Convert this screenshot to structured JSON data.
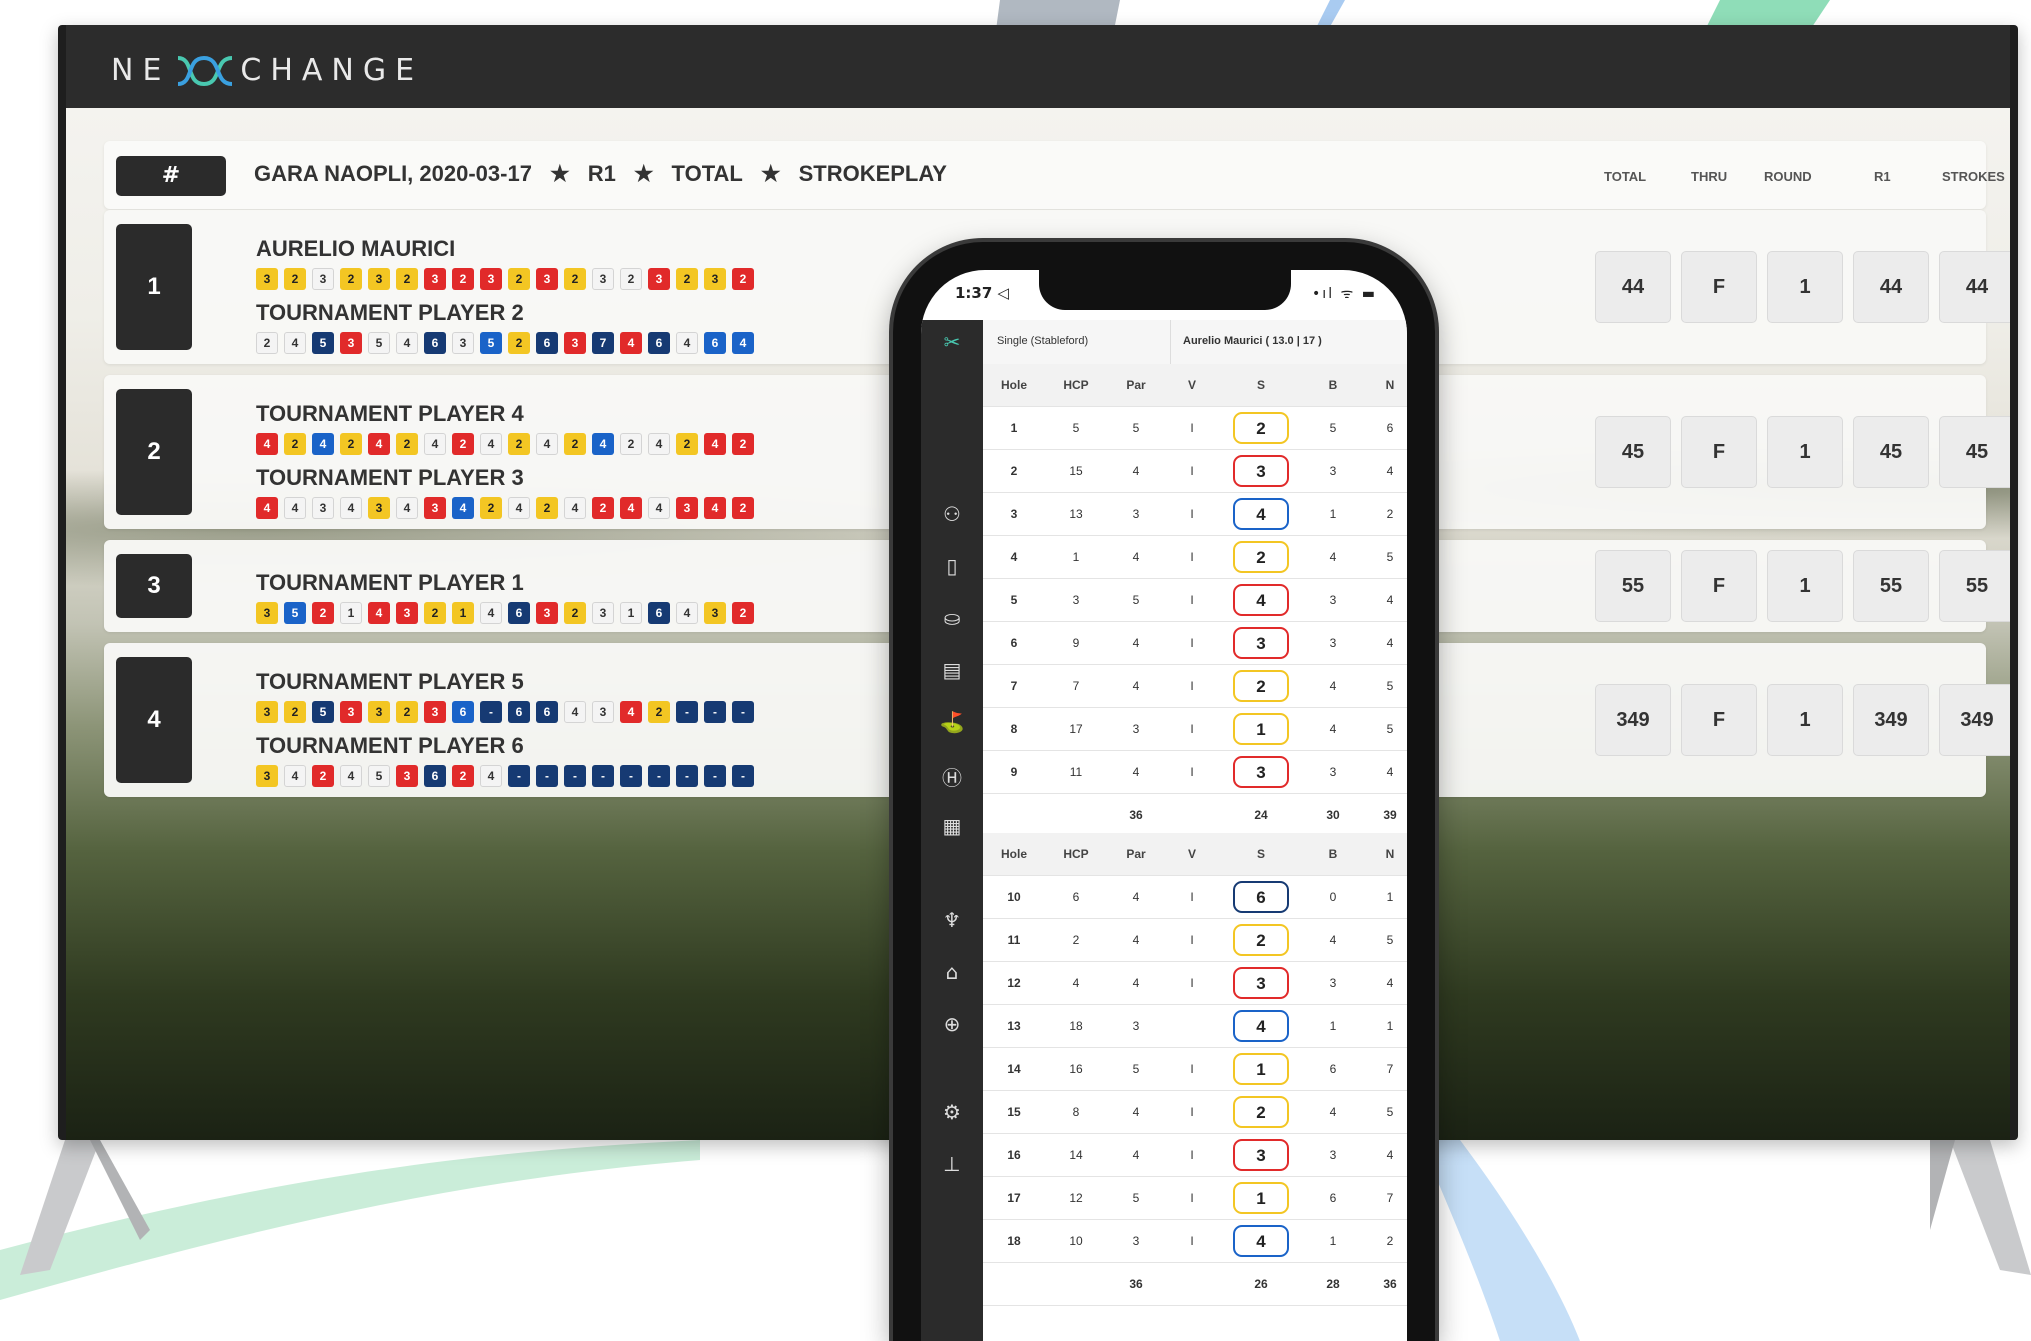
{
  "app": {
    "logo_left": "NE",
    "logo_right": "CHANGE"
  },
  "header": {
    "hash": "#",
    "title_parts": [
      "GARA NAOPLI, 2020-03-17",
      "R1",
      "TOTAL",
      "STROKEPLAY"
    ],
    "columns": [
      "TOTAL",
      "THRU",
      "ROUND",
      "R1",
      "STROKES"
    ]
  },
  "leaderboard": [
    {
      "rank": "1",
      "players": [
        {
          "name": "AURELIO MAURICI",
          "scores": [
            [
              "3",
              "y"
            ],
            [
              "2",
              "y"
            ],
            [
              "3",
              "w"
            ],
            [
              "2",
              "y"
            ],
            [
              "3",
              "y"
            ],
            [
              "2",
              "y"
            ],
            [
              "3",
              "r"
            ],
            [
              "2",
              "r"
            ],
            [
              "3",
              "r"
            ],
            [
              "2",
              "y"
            ],
            [
              "3",
              "r"
            ],
            [
              "2",
              "y"
            ],
            [
              "3",
              "w"
            ],
            [
              "2",
              "w"
            ],
            [
              "3",
              "r"
            ],
            [
              "2",
              "y"
            ],
            [
              "3",
              "y"
            ],
            [
              "2",
              "r"
            ]
          ]
        },
        {
          "name": "TOURNAMENT PLAYER 2",
          "scores": [
            [
              "2",
              "w"
            ],
            [
              "4",
              "w"
            ],
            [
              "5",
              "n"
            ],
            [
              "3",
              "r"
            ],
            [
              "5",
              "w"
            ],
            [
              "4",
              "w"
            ],
            [
              "6",
              "n"
            ],
            [
              "3",
              "w"
            ],
            [
              "5",
              "b"
            ],
            [
              "2",
              "y"
            ],
            [
              "6",
              "n"
            ],
            [
              "3",
              "r"
            ],
            [
              "7",
              "n"
            ],
            [
              "4",
              "r"
            ],
            [
              "6",
              "n"
            ],
            [
              "4",
              "w"
            ],
            [
              "6",
              "b"
            ],
            [
              "4",
              "b"
            ]
          ]
        }
      ],
      "stats": [
        "44",
        "F",
        "1",
        "44",
        "44"
      ]
    },
    {
      "rank": "2",
      "players": [
        {
          "name": "TOURNAMENT PLAYER 4",
          "scores": [
            [
              "4",
              "r"
            ],
            [
              "2",
              "y"
            ],
            [
              "4",
              "b"
            ],
            [
              "2",
              "y"
            ],
            [
              "4",
              "r"
            ],
            [
              "2",
              "y"
            ],
            [
              "4",
              "w"
            ],
            [
              "2",
              "r"
            ],
            [
              "4",
              "w"
            ],
            [
              "2",
              "y"
            ],
            [
              "4",
              "w"
            ],
            [
              "2",
              "y"
            ],
            [
              "4",
              "b"
            ],
            [
              "2",
              "w"
            ],
            [
              "4",
              "w"
            ],
            [
              "2",
              "y"
            ],
            [
              "4",
              "r"
            ],
            [
              "2",
              "r"
            ]
          ]
        },
        {
          "name": "TOURNAMENT PLAYER 3",
          "scores": [
            [
              "4",
              "r"
            ],
            [
              "4",
              "w"
            ],
            [
              "3",
              "w"
            ],
            [
              "4",
              "w"
            ],
            [
              "3",
              "y"
            ],
            [
              "4",
              "w"
            ],
            [
              "3",
              "r"
            ],
            [
              "4",
              "b"
            ],
            [
              "2",
              "y"
            ],
            [
              "4",
              "w"
            ],
            [
              "2",
              "y"
            ],
            [
              "4",
              "w"
            ],
            [
              "2",
              "r"
            ],
            [
              "4",
              "r"
            ],
            [
              "4",
              "w"
            ],
            [
              "3",
              "r"
            ],
            [
              "4",
              "r"
            ],
            [
              "2",
              "r"
            ]
          ]
        }
      ],
      "stats": [
        "45",
        "F",
        "1",
        "45",
        "45"
      ]
    },
    {
      "rank": "3",
      "players": [
        {
          "name": "TOURNAMENT PLAYER 1",
          "scores": [
            [
              "3",
              "y"
            ],
            [
              "5",
              "b"
            ],
            [
              "2",
              "r"
            ],
            [
              "1",
              "w"
            ],
            [
              "4",
              "r"
            ],
            [
              "3",
              "r"
            ],
            [
              "2",
              "y"
            ],
            [
              "1",
              "y"
            ],
            [
              "4",
              "w"
            ],
            [
              "6",
              "n"
            ],
            [
              "3",
              "r"
            ],
            [
              "2",
              "y"
            ],
            [
              "3",
              "w"
            ],
            [
              "1",
              "w"
            ],
            [
              "6",
              "n"
            ],
            [
              "4",
              "w"
            ],
            [
              "3",
              "y"
            ],
            [
              "2",
              "r"
            ]
          ]
        }
      ],
      "stats": [
        "55",
        "F",
        "1",
        "55",
        "55"
      ]
    },
    {
      "rank": "4",
      "players": [
        {
          "name": "TOURNAMENT PLAYER 5",
          "scores": [
            [
              "3",
              "y"
            ],
            [
              "2",
              "y"
            ],
            [
              "5",
              "n"
            ],
            [
              "3",
              "r"
            ],
            [
              "3",
              "y"
            ],
            [
              "2",
              "y"
            ],
            [
              "3",
              "r"
            ],
            [
              "6",
              "b"
            ],
            [
              "-",
              "n"
            ],
            [
              "6",
              "n"
            ],
            [
              "6",
              "n"
            ],
            [
              "4",
              "w"
            ],
            [
              "3",
              "w"
            ],
            [
              "4",
              "r"
            ],
            [
              "2",
              "y"
            ],
            [
              "-",
              "n"
            ],
            [
              "-",
              "n"
            ],
            [
              "-",
              "n"
            ]
          ]
        },
        {
          "name": "TOURNAMENT PLAYER 6",
          "scores": [
            [
              "3",
              "y"
            ],
            [
              "4",
              "w"
            ],
            [
              "2",
              "r"
            ],
            [
              "4",
              "w"
            ],
            [
              "5",
              "w"
            ],
            [
              "3",
              "r"
            ],
            [
              "6",
              "n"
            ],
            [
              "2",
              "r"
            ],
            [
              "4",
              "w"
            ],
            [
              "-",
              "n"
            ],
            [
              "-",
              "n"
            ],
            [
              "-",
              "n"
            ],
            [
              "-",
              "n"
            ],
            [
              "-",
              "n"
            ],
            [
              "-",
              "n"
            ],
            [
              "-",
              "n"
            ],
            [
              "-",
              "n"
            ],
            [
              "-",
              "n"
            ]
          ]
        }
      ],
      "stats": [
        "349",
        "F",
        "1",
        "349",
        "349"
      ]
    }
  ],
  "phone": {
    "time": "1:37 ◁",
    "signal": "•ıl ᯤ ▬",
    "card_left": "Single (Stableford)",
    "card_right": "Aurelio Maurici ( 13.0 | 17 )",
    "columns": [
      "Hole",
      "HCP",
      "Par",
      "V",
      "S",
      "B",
      "N"
    ],
    "front": [
      [
        "1",
        "5",
        "5",
        "I",
        "2",
        "5",
        "6",
        "y"
      ],
      [
        "2",
        "15",
        "4",
        "I",
        "3",
        "3",
        "4",
        "r"
      ],
      [
        "3",
        "13",
        "3",
        "I",
        "4",
        "1",
        "2",
        "b"
      ],
      [
        "4",
        "1",
        "4",
        "I",
        "2",
        "4",
        "5",
        "y"
      ],
      [
        "5",
        "3",
        "5",
        "I",
        "4",
        "3",
        "4",
        "r"
      ],
      [
        "6",
        "9",
        "4",
        "I",
        "3",
        "3",
        "4",
        "r"
      ],
      [
        "7",
        "7",
        "4",
        "I",
        "2",
        "4",
        "5",
        "y"
      ],
      [
        "8",
        "17",
        "3",
        "I",
        "1",
        "4",
        "5",
        "y"
      ],
      [
        "9",
        "11",
        "4",
        "I",
        "3",
        "3",
        "4",
        "r"
      ]
    ],
    "front_totals": [
      "36",
      "24",
      "30",
      "39"
    ],
    "back": [
      [
        "10",
        "6",
        "4",
        "I",
        "6",
        "0",
        "1",
        "n"
      ],
      [
        "11",
        "2",
        "4",
        "I",
        "2",
        "4",
        "5",
        "y"
      ],
      [
        "12",
        "4",
        "4",
        "I",
        "3",
        "3",
        "4",
        "r"
      ],
      [
        "13",
        "18",
        "3",
        "",
        "4",
        "1",
        "1",
        "b"
      ],
      [
        "14",
        "16",
        "5",
        "I",
        "1",
        "6",
        "7",
        "y"
      ],
      [
        "15",
        "8",
        "4",
        "I",
        "2",
        "4",
        "5",
        "y"
      ],
      [
        "16",
        "14",
        "4",
        "I",
        "3",
        "3",
        "4",
        "r"
      ],
      [
        "17",
        "12",
        "5",
        "I",
        "1",
        "6",
        "7",
        "y"
      ],
      [
        "18",
        "10",
        "3",
        "I",
        "4",
        "1",
        "2",
        "b"
      ]
    ],
    "back_totals": [
      "36",
      "26",
      "28",
      "36"
    ],
    "nav_icons": [
      "logo-icon",
      "users-icon",
      "card-icon",
      "podium-icon",
      "scorecard-icon",
      "golfer-icon",
      "h-icon",
      "calendar-icon",
      "trophy-icon",
      "home-icon",
      "globe-icon",
      "settings-icon",
      "hierarchy-icon"
    ]
  },
  "colors": {
    "yellow": "#f3c623",
    "red": "#e12a2a",
    "blue": "#1a63c8",
    "navy": "#163a73"
  }
}
